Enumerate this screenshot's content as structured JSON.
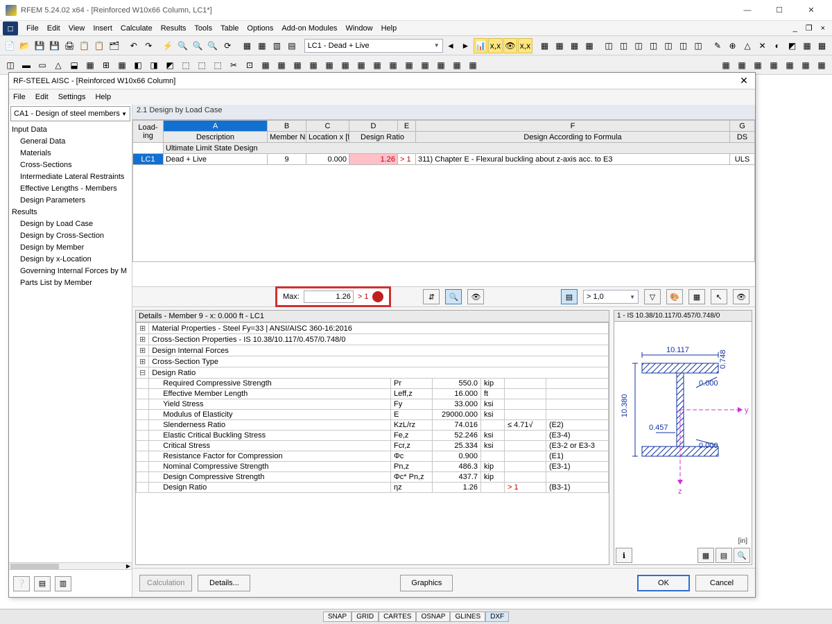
{
  "main_window": {
    "title": "RFEM 5.24.02 x64 - [Reinforced W10x66 Column, LC1*]",
    "menu": [
      "File",
      "Edit",
      "View",
      "Insert",
      "Calculate",
      "Results",
      "Tools",
      "Table",
      "Options",
      "Add-on Modules",
      "Window",
      "Help"
    ],
    "load_combo": "LC1 - Dead + Live"
  },
  "dialog": {
    "title": "RF-STEEL AISC - [Reinforced W10x66 Column]",
    "menu": [
      "File",
      "Edit",
      "Settings",
      "Help"
    ],
    "selector": "CA1 - Design of steel members",
    "tree": {
      "input_header": "Input Data",
      "input_items": [
        "General Data",
        "Materials",
        "Cross-Sections",
        "Intermediate Lateral Restraints",
        "Effective Lengths - Members",
        "Design Parameters"
      ],
      "results_header": "Results",
      "results_items": [
        "Design by Load Case",
        "Design by Cross-Section",
        "Design by Member",
        "Design by x-Location",
        "Governing Internal Forces by M",
        "Parts List by Member"
      ]
    },
    "section_header": "2.1 Design by Load Case",
    "grid": {
      "col_letters": [
        "A",
        "B",
        "C",
        "D",
        "E",
        "F",
        "G"
      ],
      "loading_hdr1": "Load-",
      "loading_hdr2": "ing",
      "headers2": [
        "Description",
        "Member No.",
        "Location x [ft]",
        "Design Ratio",
        "",
        "Design According to Formula",
        "DS"
      ],
      "subheader": "Ultimate Limit State Design",
      "row": {
        "lc": "LC1",
        "desc": "Dead + Live",
        "member": "9",
        "location": "0.000",
        "ratio": "1.26",
        "flag": "> 1",
        "formula": "311) Chapter E - Flexural buckling about z-axis acc. to E3",
        "ds": "ULS"
      }
    },
    "max": {
      "label": "Max:",
      "value": "1.26",
      "flag": "> 1"
    },
    "filter_combo": "> 1,0",
    "details": {
      "header": "Details - Member 9 - x: 0.000 ft - LC1",
      "groups": [
        "Material Properties - Steel Fy=33 | ANSI/AISC 360-16:2016",
        "Cross-Section Properties  -  IS 10.38/10.117/0.457/0.748/0",
        "Design Internal Forces",
        "Cross-Section Type",
        "Design Ratio"
      ],
      "rows": [
        {
          "label": "Required Compressive Strength",
          "sym": "Pr",
          "val": "550.0",
          "unit": "kip",
          "note": "",
          "ref": ""
        },
        {
          "label": "Effective Member Length",
          "sym": "Leff,z",
          "val": "16.000",
          "unit": "ft",
          "note": "",
          "ref": ""
        },
        {
          "label": "Yield Stress",
          "sym": "Fy",
          "val": "33.000",
          "unit": "ksi",
          "note": "",
          "ref": ""
        },
        {
          "label": "Modulus of Elasticity",
          "sym": "E",
          "val": "29000.000",
          "unit": "ksi",
          "note": "",
          "ref": ""
        },
        {
          "label": "Slenderness Ratio",
          "sym": "KzL/rz",
          "val": "74.016",
          "unit": "",
          "note": "≤ 4.71√",
          "ref": "(E2)"
        },
        {
          "label": "Elastic Critical Buckling Stress",
          "sym": "Fe,z",
          "val": "52.246",
          "unit": "ksi",
          "note": "",
          "ref": "(E3-4)"
        },
        {
          "label": "Critical Stress",
          "sym": "Fcr,z",
          "val": "25.334",
          "unit": "ksi",
          "note": "",
          "ref": "(E3-2 or E3-3"
        },
        {
          "label": "Resistance Factor for Compression",
          "sym": "Φc",
          "val": "0.900",
          "unit": "",
          "note": "",
          "ref": "(E1)"
        },
        {
          "label": "Nominal Compressive Strength",
          "sym": "Pn,z",
          "val": "486.3",
          "unit": "kip",
          "note": "",
          "ref": "(E3-1)"
        },
        {
          "label": "Design Compressive Strength",
          "sym": "Φc* Pn,z",
          "val": "437.7",
          "unit": "kip",
          "note": "",
          "ref": ""
        },
        {
          "label": "Design Ratio",
          "sym": "ηz",
          "val": "1.26",
          "unit": "",
          "note": "> 1",
          "ref": "(B3-1)",
          "warn": true
        }
      ]
    },
    "section_view": {
      "title": "1 - IS 10.38/10.117/0.457/0.748/0",
      "dims": {
        "bf": "10.117",
        "d": "10.380",
        "tf": "0.748",
        "tw": "0.457",
        "zero1": "0.000",
        "zero2": "0.000"
      },
      "axes": {
        "y": "y",
        "z": "z"
      },
      "unit": "[in]"
    },
    "footer": {
      "calculation": "Calculation",
      "details": "Details...",
      "graphics": "Graphics",
      "ok": "OK",
      "cancel": "Cancel"
    }
  },
  "statusbar": [
    "SNAP",
    "GRID",
    "CARTES",
    "OSNAP",
    "GLINES",
    "DXF"
  ]
}
